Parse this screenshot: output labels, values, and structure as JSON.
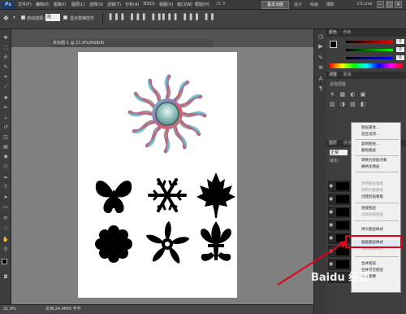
{
  "app": {
    "logo": "Ps",
    "menus": [
      "文件(F)",
      "编辑(E)",
      "图像(I)",
      "图层(L)",
      "选择(S)",
      "滤镜(T)",
      "分析(A)",
      "3D(D)",
      "视图(V)",
      "窗口(W)",
      "帮助(H)"
    ],
    "zoom": "21.9",
    "workspaces": [
      "基本功能",
      "设计",
      "绘画",
      "摄影"
    ],
    "workspace_active": "基本功能",
    "cs_live": "CS Live",
    "win_controls": [
      "–",
      "□",
      "×"
    ]
  },
  "options": {
    "auto_select_label": "自动选择：",
    "auto_select_value": "组",
    "show_transform_label": "显示变换控件"
  },
  "document": {
    "tab_label": "未标题-1 @ 21.9%(RGB/8)",
    "status_zoom": "21.9%",
    "status_doc": "文档:24.9M/0 字节"
  },
  "panels": {
    "color_tab": "颜色",
    "swatches_tab": "色板",
    "adjust_tab": "调整",
    "styles_tab": "蒙版",
    "adjust_hint": "添加调整",
    "layers_tab": "图层",
    "channels_tab": "通道",
    "paths_tab": "路径",
    "color_values": [
      "0",
      "0",
      "0"
    ],
    "layer_mode": "正常",
    "lock_label": "锁定："
  },
  "context_menu": {
    "items": [
      {
        "label": "图层属性...",
        "enabled": true
      },
      {
        "label": "混合选项...",
        "enabled": true
      },
      {
        "label": "复制图层...",
        "enabled": true
      },
      {
        "label": "删除图层",
        "enabled": true
      },
      {
        "label": "转换为智能对象",
        "enabled": true
      },
      {
        "label": "栅格化图层",
        "enabled": true
      },
      {
        "label": "停用图层蒙版",
        "enabled": false
      },
      {
        "label": "停用矢量蒙版",
        "enabled": false
      },
      {
        "label": "创建剪贴蒙版",
        "enabled": true
      },
      {
        "label": "链接图层",
        "enabled": true
      },
      {
        "label": "选择链接图层",
        "enabled": false
      },
      {
        "label": "拷贝图层样式",
        "enabled": true
      },
      {
        "label": "粘贴图层样式",
        "enabled": true
      },
      {
        "label": "清除图层样式",
        "enabled": false
      },
      {
        "label": "合并图层",
        "enabled": true
      },
      {
        "label": "合并可见图层",
        "enabled": true
      },
      {
        "label": "拼合图像",
        "enabled": true
      }
    ],
    "highlighted": "粘贴图层样式"
  },
  "watermark": "Baidu 经验",
  "colors": {
    "highlight": "#e0001a",
    "ui_dark": "#3e3e3e",
    "canvas_bg": "#808080"
  }
}
